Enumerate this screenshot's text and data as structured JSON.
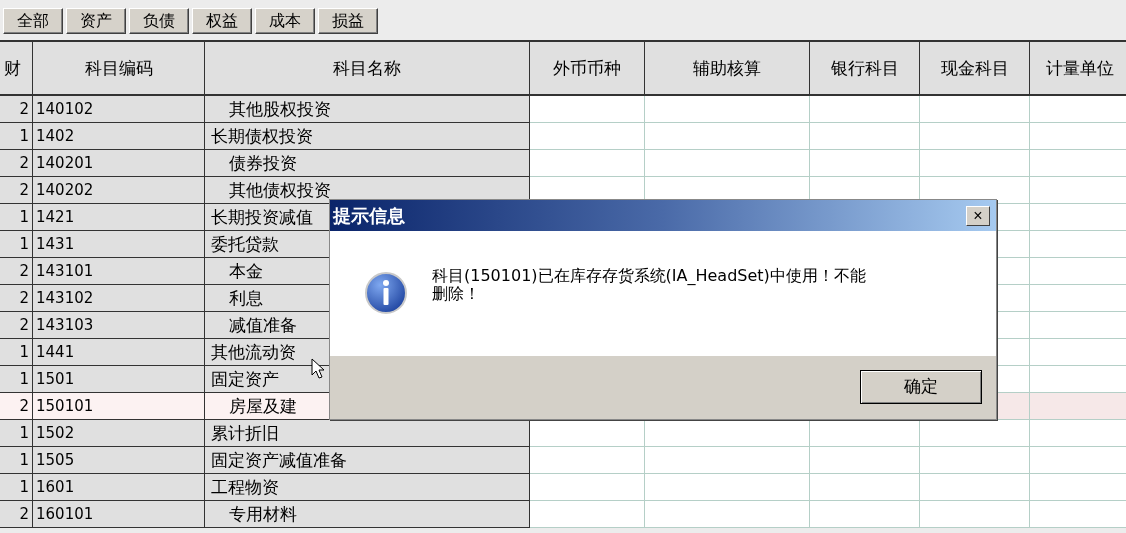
{
  "filter_buttons": [
    "全部",
    "资产",
    "负债",
    "权益",
    "成本",
    "损益"
  ],
  "table": {
    "columns": [
      "财",
      "科目编码",
      "科目名称",
      "外币币种",
      "辅助核算",
      "银行科目",
      "现金科目",
      "计量单位"
    ],
    "rows": [
      {
        "level": "2",
        "code": "140102",
        "name": "其他股权投资",
        "sub": true,
        "selected": false
      },
      {
        "level": "1",
        "code": "1402",
        "name": "长期债权投资",
        "sub": false,
        "selected": false
      },
      {
        "level": "2",
        "code": "140201",
        "name": "债券投资",
        "sub": true,
        "selected": false
      },
      {
        "level": "2",
        "code": "140202",
        "name": "其他债权投资",
        "sub": true,
        "selected": false
      },
      {
        "level": "1",
        "code": "1421",
        "name": "长期投资减值",
        "sub": false,
        "selected": false
      },
      {
        "level": "1",
        "code": "1431",
        "name": "委托贷款",
        "sub": false,
        "selected": false
      },
      {
        "level": "2",
        "code": "143101",
        "name": "本金",
        "sub": true,
        "selected": false
      },
      {
        "level": "2",
        "code": "143102",
        "name": "利息",
        "sub": true,
        "selected": false
      },
      {
        "level": "2",
        "code": "143103",
        "name": "减值准备",
        "sub": true,
        "selected": false
      },
      {
        "level": "1",
        "code": "1441",
        "name": "其他流动资",
        "sub": false,
        "selected": false
      },
      {
        "level": "1",
        "code": "1501",
        "name": "固定资产",
        "sub": false,
        "selected": false
      },
      {
        "level": "2",
        "code": "150101",
        "name": "房屋及建",
        "sub": true,
        "selected": true
      },
      {
        "level": "1",
        "code": "1502",
        "name": "累计折旧",
        "sub": false,
        "selected": false
      },
      {
        "level": "1",
        "code": "1505",
        "name": "固定资产减值准备",
        "sub": false,
        "selected": false
      },
      {
        "level": "1",
        "code": "1601",
        "name": "工程物资",
        "sub": false,
        "selected": false
      },
      {
        "level": "2",
        "code": "160101",
        "name": "专用材料",
        "sub": true,
        "selected": false
      }
    ]
  },
  "dialog": {
    "title": "提示信息",
    "close": "×",
    "message": "科目(150101)已在库存存货系统(IA_HeadSet)中使用！不能删除！",
    "ok_button": "确定"
  }
}
